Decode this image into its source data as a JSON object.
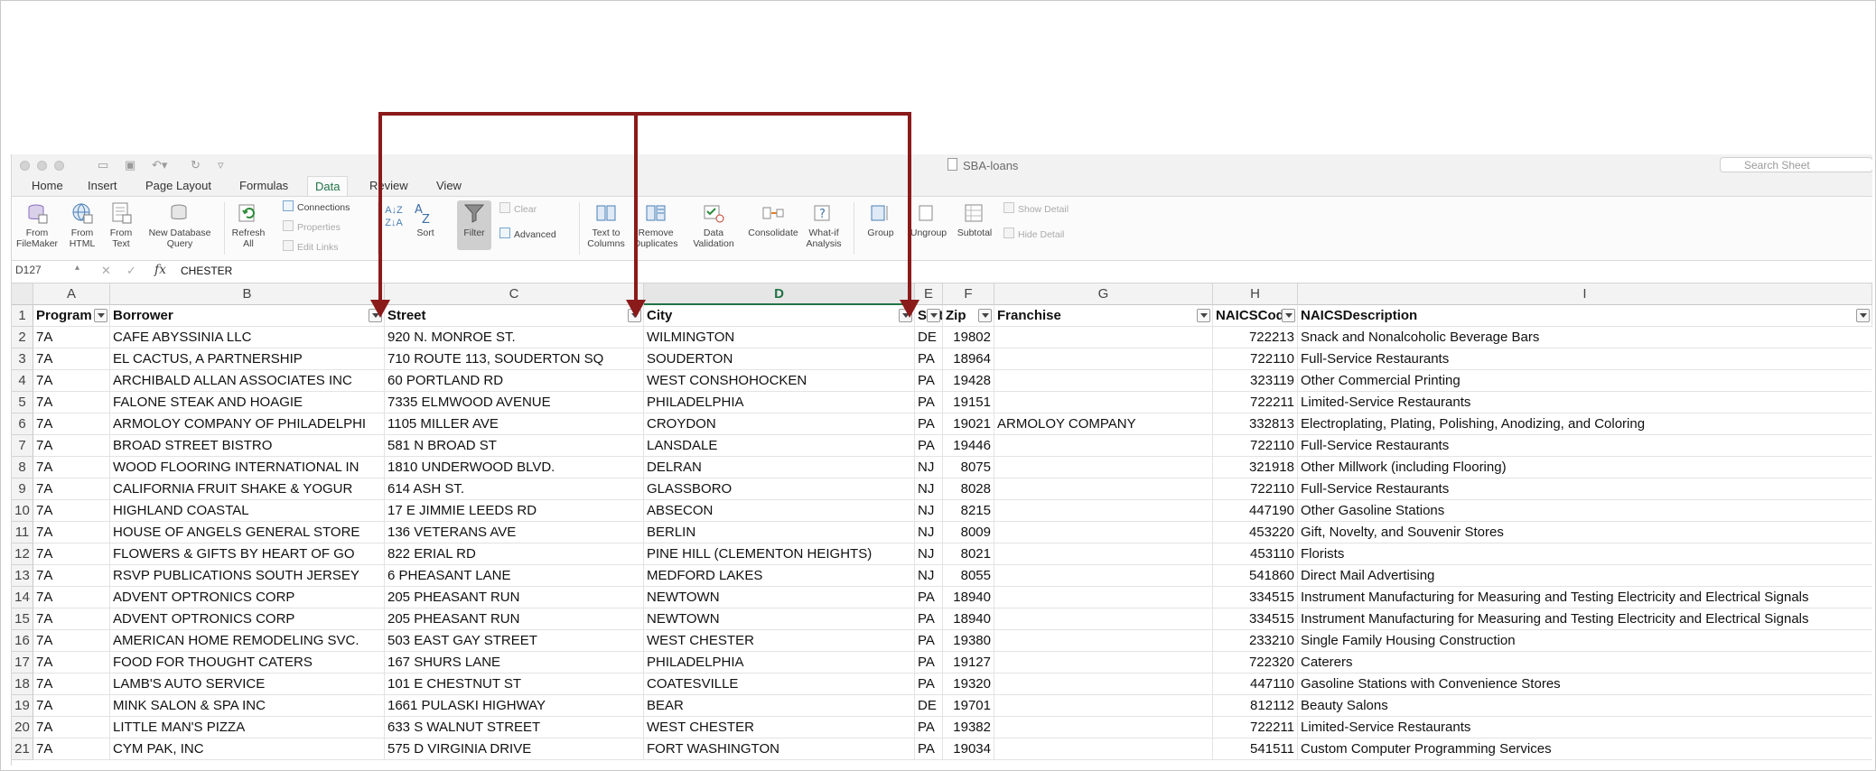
{
  "window": {
    "title": "SBA-loans",
    "search_placeholder": "Search Sheet"
  },
  "tabs": [
    {
      "label": "Home",
      "active": false
    },
    {
      "label": "Insert",
      "active": false
    },
    {
      "label": "Page Layout",
      "active": false
    },
    {
      "label": "Formulas",
      "active": false
    },
    {
      "label": "Data",
      "active": true
    },
    {
      "label": "Review",
      "active": false
    },
    {
      "label": "View",
      "active": false
    }
  ],
  "ribbon": {
    "from_filemaker": [
      "From",
      "FileMaker"
    ],
    "from_html": [
      "From",
      "HTML"
    ],
    "from_text": [
      "From",
      "Text"
    ],
    "new_db_query": [
      "New Database",
      "Query"
    ],
    "refresh_all": [
      "Refresh",
      "All"
    ],
    "connections": "Connections",
    "properties": "Properties",
    "edit_links": "Edit Links",
    "sort": "Sort",
    "filter": "Filter",
    "clear": "Clear",
    "advanced": "Advanced",
    "text_to_columns": [
      "Text to",
      "Columns"
    ],
    "remove_duplicates": [
      "Remove",
      "Duplicates"
    ],
    "data_validation": [
      "Data",
      "Validation"
    ],
    "consolidate": "Consolidate",
    "what_if": [
      "What-if",
      "Analysis"
    ],
    "group": "Group",
    "ungroup": "Ungroup",
    "subtotal": "Subtotal",
    "show_detail": "Show Detail",
    "hide_detail": "Hide Detail"
  },
  "formula_bar": {
    "name_box": "D127",
    "fx": "fx",
    "value": "CHESTER"
  },
  "columns": [
    "A",
    "B",
    "C",
    "D",
    "E",
    "F",
    "G",
    "H",
    "I"
  ],
  "selected_column": "D",
  "headers": [
    "Program",
    "Borrower",
    "Street",
    "City",
    "State",
    "Zip",
    "Franchise",
    "NAICSCode",
    "NAICSDescription"
  ],
  "rows": [
    {
      "n": "2",
      "c": [
        "7A",
        "CAFE ABYSSINIA LLC",
        "920 N. MONROE ST.",
        "WILMINGTON",
        "DE",
        "19802",
        "",
        "722213",
        "Snack and Nonalcoholic Beverage Bars"
      ]
    },
    {
      "n": "3",
      "c": [
        "7A",
        "EL CACTUS, A PARTNERSHIP",
        "710 ROUTE 113, SOUDERTON SQ",
        "SOUDERTON",
        "PA",
        "18964",
        "",
        "722110",
        "Full-Service Restaurants"
      ]
    },
    {
      "n": "4",
      "c": [
        "7A",
        "ARCHIBALD ALLAN ASSOCIATES INC",
        "60 PORTLAND RD",
        "WEST CONSHOHOCKEN",
        "PA",
        "19428",
        "",
        "323119",
        "Other Commercial Printing"
      ]
    },
    {
      "n": "5",
      "c": [
        "7A",
        "FALONE STEAK AND HOAGIE",
        "7335 ELMWOOD AVENUE",
        "PHILADELPHIA",
        "PA",
        "19151",
        "",
        "722211",
        "Limited-Service Restaurants"
      ]
    },
    {
      "n": "6",
      "c": [
        "7A",
        "ARMOLOY COMPANY OF PHILADELPHI",
        "1105 MILLER AVE",
        "CROYDON",
        "PA",
        "19021",
        "ARMOLOY COMPANY",
        "332813",
        "Electroplating, Plating, Polishing, Anodizing, and Coloring"
      ]
    },
    {
      "n": "7",
      "c": [
        "7A",
        "BROAD STREET BISTRO",
        "581 N BROAD ST",
        "LANSDALE",
        "PA",
        "19446",
        "",
        "722110",
        "Full-Service Restaurants"
      ]
    },
    {
      "n": "8",
      "c": [
        "7A",
        "WOOD FLOORING INTERNATIONAL IN",
        "1810 UNDERWOOD BLVD.",
        "DELRAN",
        "NJ",
        "8075",
        "",
        "321918",
        "Other Millwork (including Flooring)"
      ]
    },
    {
      "n": "9",
      "c": [
        "7A",
        "CALIFORNIA FRUIT SHAKE & YOGUR",
        "614 ASH ST.",
        "GLASSBORO",
        "NJ",
        "8028",
        "",
        "722110",
        "Full-Service Restaurants"
      ]
    },
    {
      "n": "10",
      "c": [
        "7A",
        "HIGHLAND COASTAL",
        "17 E JIMMIE LEEDS RD",
        "ABSECON",
        "NJ",
        "8215",
        "",
        "447190",
        "Other Gasoline Stations"
      ]
    },
    {
      "n": "11",
      "c": [
        "7A",
        "HOUSE OF ANGELS GENERAL STORE",
        "136 VETERANS AVE",
        "BERLIN",
        "NJ",
        "8009",
        "",
        "453220",
        "Gift, Novelty, and Souvenir Stores"
      ]
    },
    {
      "n": "12",
      "c": [
        "7A",
        "FLOWERS & GIFTS BY HEART OF GO",
        "822 ERIAL RD",
        "PINE HILL (CLEMENTON HEIGHTS)",
        "NJ",
        "8021",
        "",
        "453110",
        "Florists"
      ]
    },
    {
      "n": "13",
      "c": [
        "7A",
        "RSVP PUBLICATIONS SOUTH JERSEY",
        "6 PHEASANT LANE",
        "MEDFORD LAKES",
        "NJ",
        "8055",
        "",
        "541860",
        "Direct Mail Advertising"
      ]
    },
    {
      "n": "14",
      "c": [
        "7A",
        "ADVENT OPTRONICS CORP",
        "205 PHEASANT RUN",
        "NEWTOWN",
        "PA",
        "18940",
        "",
        "334515",
        "Instrument Manufacturing for Measuring and Testing Electricity and Electrical Signals"
      ]
    },
    {
      "n": "15",
      "c": [
        "7A",
        "ADVENT OPTRONICS CORP",
        "205 PHEASANT RUN",
        "NEWTOWN",
        "PA",
        "18940",
        "",
        "334515",
        "Instrument Manufacturing for Measuring and Testing Electricity and Electrical Signals"
      ]
    },
    {
      "n": "16",
      "c": [
        "7A",
        "AMERICAN HOME REMODELING SVC.",
        "503 EAST GAY STREET",
        "WEST CHESTER",
        "PA",
        "19380",
        "",
        "233210",
        "Single Family Housing Construction"
      ]
    },
    {
      "n": "17",
      "c": [
        "7A",
        "FOOD FOR THOUGHT CATERS",
        "167 SHURS LANE",
        "PHILADELPHIA",
        "PA",
        "19127",
        "",
        "722320",
        "Caterers"
      ]
    },
    {
      "n": "18",
      "c": [
        "7A",
        "LAMB'S AUTO SERVICE",
        "101 E CHESTNUT ST",
        "COATESVILLE",
        "PA",
        "19320",
        "",
        "447110",
        "Gasoline Stations with Convenience Stores"
      ]
    },
    {
      "n": "19",
      "c": [
        "7A",
        "MINK SALON & SPA INC",
        "1661 PULASKI HIGHWAY",
        "BEAR",
        "DE",
        "19701",
        "",
        "812112",
        "Beauty Salons"
      ]
    },
    {
      "n": "20",
      "c": [
        "7A",
        "LITTLE MAN'S PIZZA",
        "633 S WALNUT STREET",
        "WEST CHESTER",
        "PA",
        "19382",
        "",
        "722211",
        "Limited-Service Restaurants"
      ]
    },
    {
      "n": "21",
      "c": [
        "7A",
        "CYM PAK, INC",
        "575 D VIRGINIA DRIVE",
        "FORT WASHINGTON",
        "PA",
        "19034",
        "",
        "541511",
        "Custom Computer Programming Services"
      ]
    }
  ],
  "annotation": {
    "color": "#8b1a1a"
  }
}
